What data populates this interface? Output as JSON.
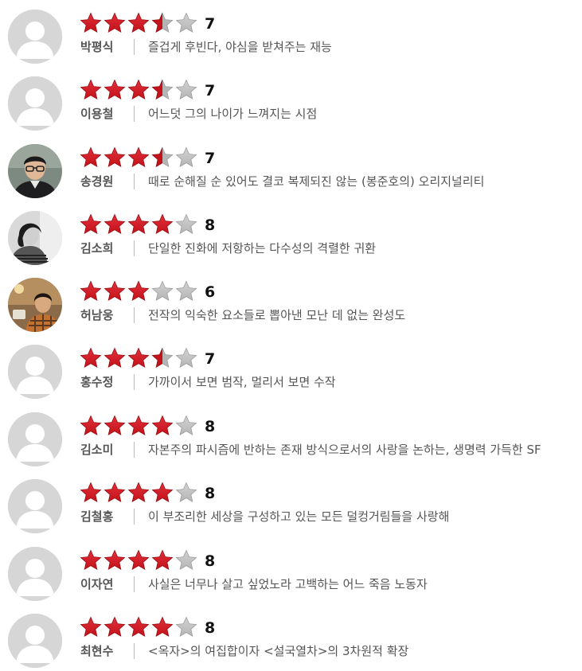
{
  "colors": {
    "star_filled": "#c4121a",
    "star_empty": "#b5b5b5",
    "avatar_placeholder": "#d6d6d6"
  },
  "reviews": [
    {
      "name": "박평식",
      "score": "7",
      "rating": 3.5,
      "avatar": "placeholder-avatar-icon",
      "comment": "즐겁게 후빈다, 야심을 받쳐주는 재능"
    },
    {
      "name": "이용철",
      "score": "7",
      "rating": 3.5,
      "avatar": "placeholder-avatar-icon",
      "comment": "어느덧 그의 나이가 느껴지는 시점"
    },
    {
      "name": "송경원",
      "score": "7",
      "rating": 3.5,
      "avatar": "profile-photo-man-glasses",
      "comment": "때로 순해질 순 있어도 결코 복제되진 않는 (봉준호의) 오리지널리티"
    },
    {
      "name": "김소희",
      "score": "8",
      "rating": 4,
      "avatar": "profile-photo-woman-bw",
      "comment": "단일한 진화에 저항하는 다수성의 격렬한 귀환"
    },
    {
      "name": "허남웅",
      "score": "6",
      "rating": 3,
      "avatar": "profile-photo-man-plaid",
      "comment": "전작의 익숙한 요소들로 뽑아낸 모난 데 없는 완성도"
    },
    {
      "name": "홍수정",
      "score": "7",
      "rating": 3.5,
      "avatar": "placeholder-avatar-icon",
      "comment": "가까이서 보면 범작, 멀리서 보면 수작"
    },
    {
      "name": "김소미",
      "score": "8",
      "rating": 4,
      "avatar": "placeholder-avatar-icon",
      "comment": "자본주의 파시즘에 반하는 존재 방식으로서의 사랑을 논하는, 생명력 가득한 SF"
    },
    {
      "name": "김철홍",
      "score": "8",
      "rating": 4,
      "avatar": "placeholder-avatar-icon",
      "comment": "이 부조리한 세상을 구성하고 있는 모든 덜컹거림들을 사랑해"
    },
    {
      "name": "이자연",
      "score": "8",
      "rating": 4,
      "avatar": "placeholder-avatar-icon",
      "comment": "사실은 너무나 살고 싶었노라 고백하는 어느 죽음 노동자"
    },
    {
      "name": "최현수",
      "score": "8",
      "rating": 4,
      "avatar": "placeholder-avatar-icon",
      "comment": "<옥자>의 여집합이자 <설국열차>의 3차원적 확장"
    }
  ]
}
